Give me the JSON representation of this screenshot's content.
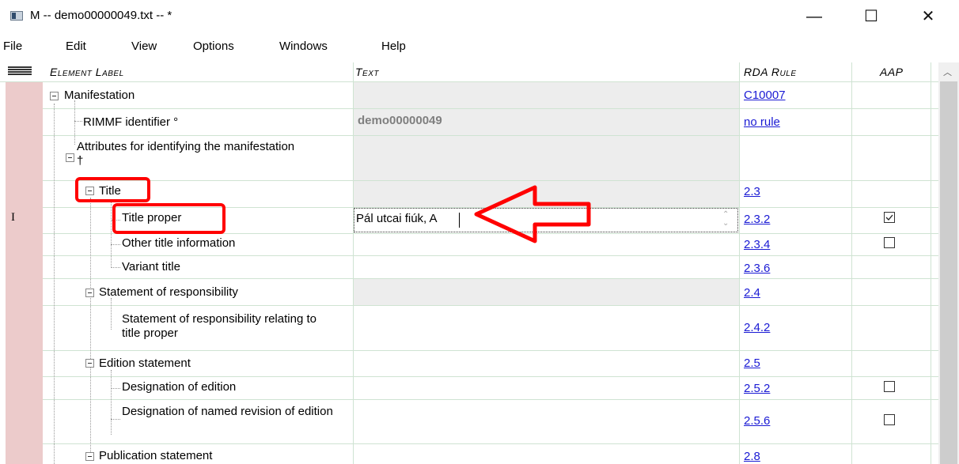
{
  "window": {
    "title": "M  --  demo00000049.txt  -- *",
    "minimize": "—",
    "maximize": "☐",
    "close": "✕"
  },
  "menu": [
    "File",
    "Edit",
    "View",
    "Options",
    "Windows",
    "Help"
  ],
  "headers": {
    "element_label": "Element Label",
    "text": "Text",
    "rda_rule": "RDA Rule",
    "aap": "AAP"
  },
  "rows": [
    {
      "label": "Manifestation",
      "text": "",
      "rule": "C10007"
    },
    {
      "label": "RIMMF identifier °",
      "text": "demo00000049",
      "rule": "no rule"
    },
    {
      "label": "Attributes for identifying the manifestation †",
      "text": "",
      "rule": ""
    },
    {
      "label": "Title",
      "text": "",
      "rule": "2.3"
    },
    {
      "label": "Title proper",
      "text": "Pál utcai fiúk, A",
      "rule": "2.3.2",
      "aap": "checked"
    },
    {
      "label": "Other title information",
      "text": "",
      "rule": "2.3.4",
      "aap": "unchecked"
    },
    {
      "label": "Variant title",
      "text": "",
      "rule": "2.3.6"
    },
    {
      "label": "Statement of responsibility",
      "text": "",
      "rule": "2.4"
    },
    {
      "label": "Statement of responsibility relating to title proper",
      "text": "",
      "rule": "2.4.2"
    },
    {
      "label": "Edition statement",
      "text": "",
      "rule": "2.5"
    },
    {
      "label": "Designation of edition",
      "text": "",
      "rule": "2.5.2",
      "aap": "unchecked"
    },
    {
      "label": "Designation of named revision of edition",
      "text": "",
      "rule": "2.5.6",
      "aap": "unchecked"
    },
    {
      "label": "Publication statement",
      "text": "",
      "rule": "2.8"
    }
  ],
  "cursor_glyph": "I",
  "annotation_color": "#ff0000"
}
